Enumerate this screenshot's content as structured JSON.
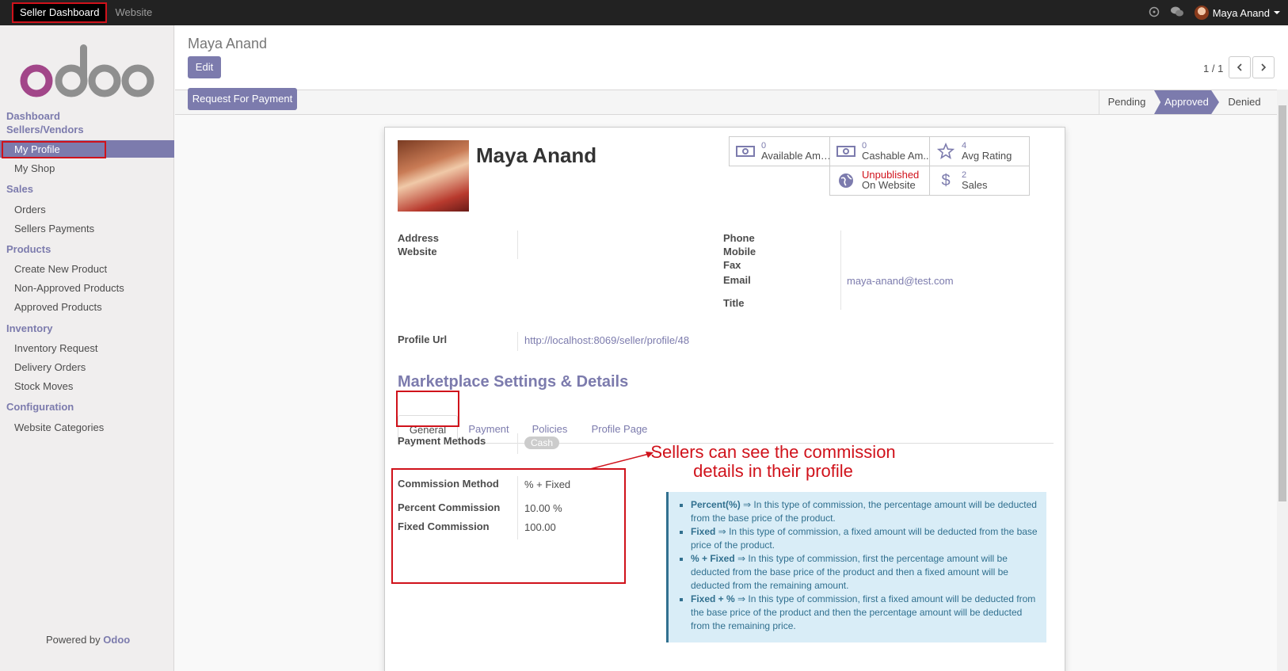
{
  "topbar": {
    "menu": [
      "Seller Dashboard",
      "Website"
    ],
    "user": "Maya Anand"
  },
  "sidebar": {
    "dashboard": "Dashboard",
    "sellers": "Sellers/Vendors",
    "my_profile": "My Profile",
    "my_shop": "My Shop",
    "sales": "Sales",
    "orders": "Orders",
    "sellers_payments": "Sellers Payments",
    "products": "Products",
    "create_new_product": "Create New Product",
    "non_approved_products": "Non-Approved Products",
    "approved_products": "Approved Products",
    "inventory": "Inventory",
    "inventory_request": "Inventory Request",
    "delivery_orders": "Delivery Orders",
    "stock_moves": "Stock Moves",
    "configuration": "Configuration",
    "website_categories": "Website Categories",
    "powered_by": "Powered by",
    "odoo": "Odoo"
  },
  "control_panel": {
    "title": "Maya Anand",
    "edit": "Edit",
    "pager": "1 / 1",
    "request_payment": "Request For Payment",
    "stages": [
      "Pending",
      "Approved",
      "Denied"
    ]
  },
  "form": {
    "name": "Maya Anand",
    "smart_buttons": {
      "available": {
        "value": "0",
        "label": "Available Amo..."
      },
      "cashable": {
        "value": "0",
        "label": "Cashable Am..."
      },
      "rating": {
        "value": "4",
        "label": "Avg Rating"
      },
      "website": {
        "value": "Unpublished",
        "label": "On Website"
      },
      "sales": {
        "value": "2",
        "label": "Sales"
      }
    },
    "labels": {
      "address": "Address",
      "website": "Website",
      "phone": "Phone",
      "mobile": "Mobile",
      "fax": "Fax",
      "email": "Email",
      "title": "Title",
      "profile_url": "Profile Url"
    },
    "email": "maya-anand@test.com",
    "profile_url": "http://localhost:8069/seller/profile/48",
    "section_title": "Marketplace Settings & Details",
    "tabs": [
      "General",
      "Payment",
      "Policies",
      "Profile Page"
    ],
    "payment_methods_label": "Payment Methods",
    "payment_method": "Cash",
    "commission_method_label": "Commission Method",
    "commission_method": "% + Fixed",
    "percent_commission_label": "Percent Commission",
    "percent_commission": "10.00 %",
    "fixed_commission_label": "Fixed Commission",
    "fixed_commission": "100.00",
    "annotation": "Sellers can see the commission details in their profile",
    "info": [
      {
        "term": "Percent(%)",
        "text": " ⇒ In this type of commission, the percentage amount will be deducted from the base price of the product."
      },
      {
        "term": "Fixed",
        "text": " ⇒ In this type of commission, a fixed amount will be deducted from the base price of the product."
      },
      {
        "term": "% + Fixed",
        "text": " ⇒ In this type of commission, first the percentage amount will be deducted from the base price of the product and then a fixed amount will be deducted from the remaining amount."
      },
      {
        "term": "Fixed + %",
        "text": " ⇒ In this type of commission, first a fixed amount will be deducted from the base price of the product and then the percentage amount will be deducted from the remaining price."
      }
    ]
  }
}
